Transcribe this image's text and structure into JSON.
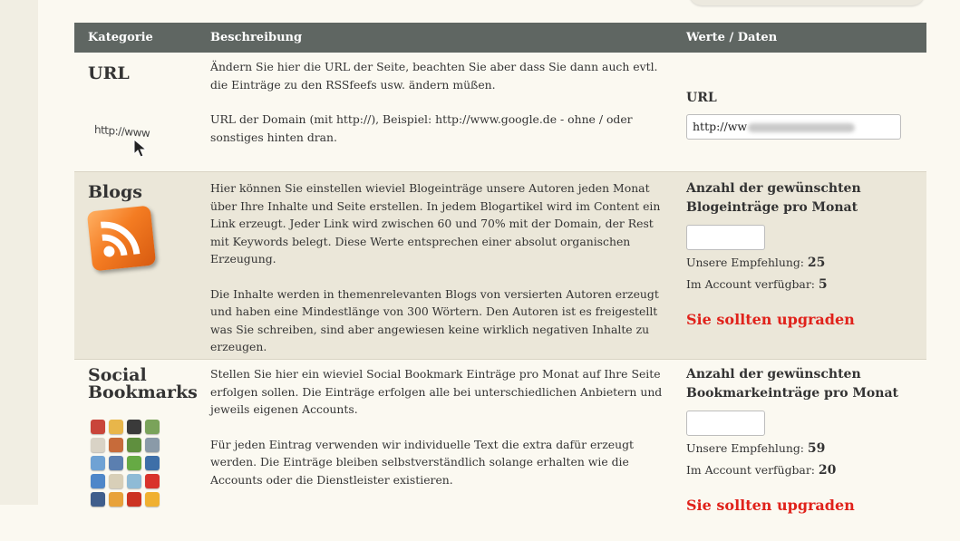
{
  "header": {
    "col_category": "Kategorie",
    "col_description": "Beschreibung",
    "col_values": "Werte / Daten"
  },
  "url_row": {
    "category": "URL",
    "icon_text": "http://www",
    "desc_p1": "Ändern Sie hier die URL der Seite, beachten Sie aber dass Sie dann auch evtl. die Einträge zu den RSSfeefs usw. ändern müßen.",
    "desc_p2": "URL der Domain (mit http://), Beispiel: http://www.google.de - ohne / oder sonstiges hinten dran.",
    "value_heading": "URL",
    "input_prefix": "http://ww"
  },
  "blogs_row": {
    "category": "Blogs",
    "desc_p1": "Hier können Sie einstellen wieviel Blogeinträge unsere Autoren jeden Monat über Ihre Inhalte und Seite erstellen. In jedem Blogartikel wird im Content ein Link erzeugt. Jeder Link wird zwischen 60 und 70% mit der Domain, der Rest mit Keywords belegt. Diese Werte entsprechen einer absolut organischen Erzeugung.",
    "desc_p2": "Die Inhalte werden in themenrelevanten Blogs von versierten Autoren erzeugt und haben eine Mindestlänge von 300 Wörtern. Den Autoren ist es freigestellt was Sie schreiben, sind aber angewiesen keine wirklich negativen Inhalte zu erzeugen.",
    "value_heading": "Anzahl der gewünschten Blogeinträge pro Monat",
    "input_value": "",
    "recommend_label": "Unsere Empfehlung:",
    "recommend_value": "25",
    "available_label": "Im Account verfügbar:",
    "available_value": "5",
    "upgrade_text": "Sie sollten upgraden"
  },
  "social_row": {
    "category_line1": "Social",
    "category_line2": "Bookmarks",
    "desc_p1": "Stellen Sie hier ein wieviel Social Bookmark Einträge pro Monat auf Ihre Seite erfolgen sollen. Die Einträge erfolgen alle bei unterschiedlichen Anbietern und jeweils eigenen Accounts.",
    "desc_p2": "Für jeden Eintrag verwenden wir individuelle Text die extra dafür erzeugt werden. Die Einträge bleiben selbstverständlich solange erhalten wie die Accounts oder die Dienstleister existieren.",
    "value_heading": "Anzahl der gewünschten Bookmarkeinträge pro Monat",
    "input_value": "",
    "recommend_label": "Unsere Empfehlung:",
    "recommend_value": "59",
    "available_label": "Im Account verfügbar:",
    "available_value": "20",
    "upgrade_text": "Sie sollten upgraden"
  },
  "colors": {
    "header_bg": "#5f6662",
    "alt_row_bg": "#ebe7d9",
    "page_bg": "#fbf9f1",
    "upgrade_red": "#e0221b"
  }
}
